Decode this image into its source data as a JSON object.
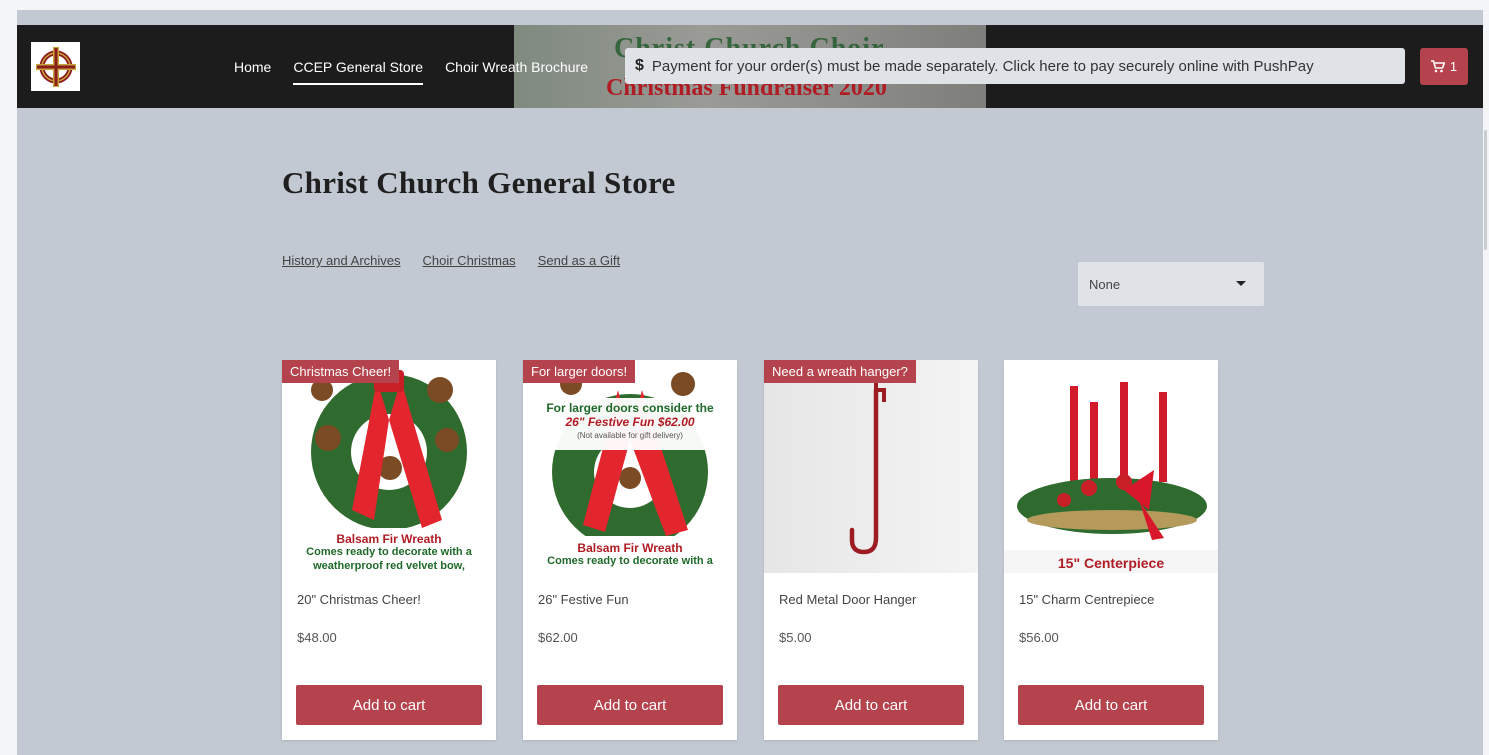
{
  "nav": {
    "links": [
      "Home",
      "CCEP General Store",
      "Choir Wreath Brochure"
    ],
    "active_index": 1
  },
  "banner": {
    "line1": "Christ Church Choir",
    "line2": "Christmas Fundraiser 2020"
  },
  "payment_notice": {
    "symbol": "$",
    "text": "Payment for your order(s) must be made separately. Click here to pay securely online with PushPay"
  },
  "cart": {
    "count": "1",
    "icon": "cart-icon"
  },
  "page": {
    "title": "Christ Church General Store"
  },
  "categories": [
    "History and Archives",
    "Choir Christmas",
    "Send as a Gift"
  ],
  "sort_select": {
    "value": "None"
  },
  "products": [
    {
      "badge": "Christmas Cheer!",
      "name": "20\" Christmas Cheer!",
      "price": "$48.00",
      "button": "Add to cart",
      "image_caption": [
        "Balsam Fir Wreath",
        "Comes ready to decorate with a",
        "weatherproof red velvet bow,"
      ]
    },
    {
      "badge": "For larger doors!",
      "name": "26\" Festive Fun",
      "price": "$62.00",
      "button": "Add to cart",
      "image_note": [
        "For larger doors consider the",
        "26\" Festive Fun $62.00",
        "(Not available for gift delivery)"
      ],
      "image_caption": [
        "Balsam Fir Wreath",
        "Comes ready to decorate with a"
      ]
    },
    {
      "badge": "Need a wreath hanger?",
      "name": "Red Metal Door Hanger",
      "price": "$5.00",
      "button": "Add to cart"
    },
    {
      "badge": "",
      "name": "15\" Charm Centrepiece",
      "price": "$56.00",
      "button": "Add to cart",
      "image_caption": [
        "15\" Centerpiece"
      ]
    }
  ],
  "colors": {
    "accent": "#b5434d",
    "navbar": "#1c1c1c",
    "page_bg": "#c3c9d2"
  }
}
